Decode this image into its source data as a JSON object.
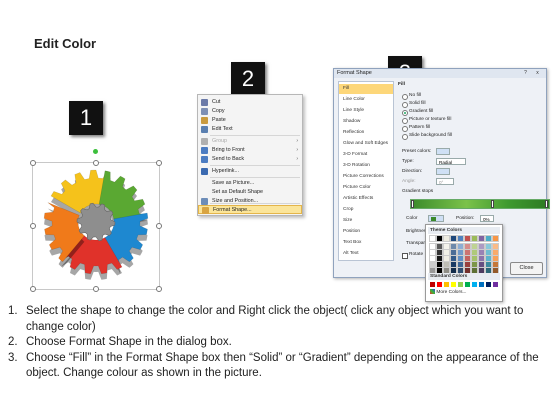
{
  "title": "Edit Color",
  "steps": [
    "1",
    "2",
    "3"
  ],
  "context_menu": {
    "items": [
      {
        "label": "Cut",
        "icon": "scissors-icon",
        "color": "#6b7aa8"
      },
      {
        "label": "Copy",
        "icon": "copy-icon",
        "color": "#7d8fb5"
      },
      {
        "label": "Paste",
        "icon": "paste-icon",
        "color": "#c99a3e"
      },
      {
        "label": "Edit Text",
        "icon": "edit-text-icon",
        "color": "#5a7fb0"
      },
      {
        "label": "Group",
        "icon": "group-icon",
        "color": "#b0b0b0",
        "dim": true,
        "arrow": true
      },
      {
        "label": "Bring to Front",
        "icon": "bring-front-icon",
        "color": "#4b7cc2",
        "arrow": true
      },
      {
        "label": "Send to Back",
        "icon": "send-back-icon",
        "color": "#4b7cc2",
        "arrow": true
      },
      {
        "label": "Hyperlink...",
        "icon": "hyperlink-icon",
        "color": "#3b6ab0"
      },
      {
        "label": "Save as Picture...",
        "icon": "",
        "color": ""
      },
      {
        "label": "Set as Default Shape",
        "icon": "",
        "color": ""
      },
      {
        "label": "Size and Position...",
        "icon": "size-icon",
        "color": "#6d8db8"
      },
      {
        "label": "Format Shape...",
        "icon": "format-shape-icon",
        "color": "#d9a441",
        "highlight": true
      }
    ]
  },
  "dialog": {
    "title": "Format Shape",
    "help": "?",
    "close_x": "x",
    "nav_items": [
      "Fill",
      "Line Color",
      "Line Style",
      "Shadow",
      "Reflection",
      "Glow and Soft Edges",
      "3-D Format",
      "3-D Rotation",
      "Picture Corrections",
      "Picture Color",
      "Artistic Effects",
      "Crop",
      "Size",
      "Position",
      "Text Box",
      "Alt Text"
    ],
    "pane": {
      "heading": "Fill",
      "options": [
        "No fill",
        "Solid fill",
        "Gradient fill",
        "Picture or texture fill",
        "Pattern fill",
        "Slide background fill"
      ],
      "selected_option": 2,
      "preset_label": "Preset colors:",
      "type_label": "Type:",
      "type_value": "Radial",
      "direction_label": "Direction:",
      "angle_label": "Angle:",
      "angle_value": "0°",
      "stops_label": "Gradient stops",
      "color_label": "Color",
      "position_label": "Position:",
      "position_value": "0%",
      "brightness_label": "Brightness",
      "transparency_label": "Transparen",
      "rotate_label": "Rotate"
    },
    "close_button": "Close"
  },
  "palette": {
    "theme_label": "Theme Colors",
    "standard_label": "Standard Colors",
    "more_label": "More Colors...",
    "theme_colors": [
      "#ffffff",
      "#000000",
      "#eeece1",
      "#1f497d",
      "#4f81bd",
      "#c0504d",
      "#9bbb59",
      "#8064a2",
      "#4bacc6",
      "#f79646"
    ],
    "standard_colors": [
      "#c00000",
      "#ff0000",
      "#ffc000",
      "#ffff00",
      "#92d050",
      "#00b050",
      "#00b0f0",
      "#0070c0",
      "#002060",
      "#7030a0"
    ]
  },
  "instructions": [
    {
      "num": "1.",
      "text": "Select the shape to change the color and Right click the object( click any object which you want to change color)"
    },
    {
      "num": "2.",
      "text": "Choose Format Shape in the dialog box."
    },
    {
      "num": "3.",
      "text": "Choose “Fill” in the Format Shape box then “Solid” or “Gradient” depending on the appearance of the object. Change colour as shown in the picture."
    }
  ],
  "gear_colors": [
    "#f5c21b",
    "#5aa832",
    "#1e88d0",
    "#e0322a",
    "#f07a1a",
    "#8e8e8e"
  ]
}
